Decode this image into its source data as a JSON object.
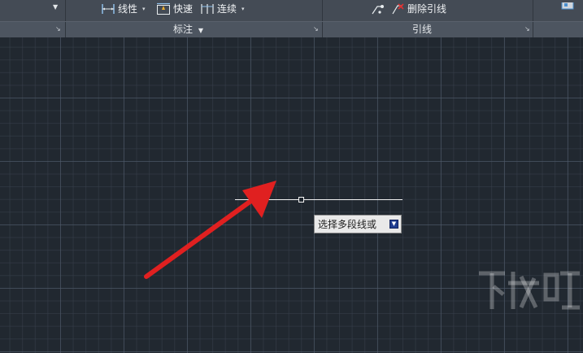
{
  "ribbon": {
    "panels": [
      {
        "title": "",
        "launcher": "↘"
      },
      {
        "title": "标注",
        "launcher": "↘"
      },
      {
        "title": "引线",
        "launcher": "↘"
      },
      {
        "title": ""
      }
    ],
    "dimension_tools": [
      {
        "label": "线性",
        "icon": "linear-dimension-icon"
      },
      {
        "label": "快速",
        "icon": "quick-dimension-icon"
      },
      {
        "label": "连续",
        "icon": "continue-dimension-icon"
      }
    ],
    "leader_tools": [
      {
        "label": "删除引线",
        "icon": "remove-leader-icon"
      }
    ],
    "dimension_panel_caret": "▼",
    "caret": "▾"
  },
  "canvas": {
    "tooltip": {
      "text": "选择多段线或",
      "button_icon": "dropdown-arrow-icon"
    }
  },
  "colors": {
    "ribbon_bg": "#444b55",
    "canvas_bg": "#212830",
    "annotation_arrow": "#e02020",
    "polyline": "#f2f2f2"
  }
}
